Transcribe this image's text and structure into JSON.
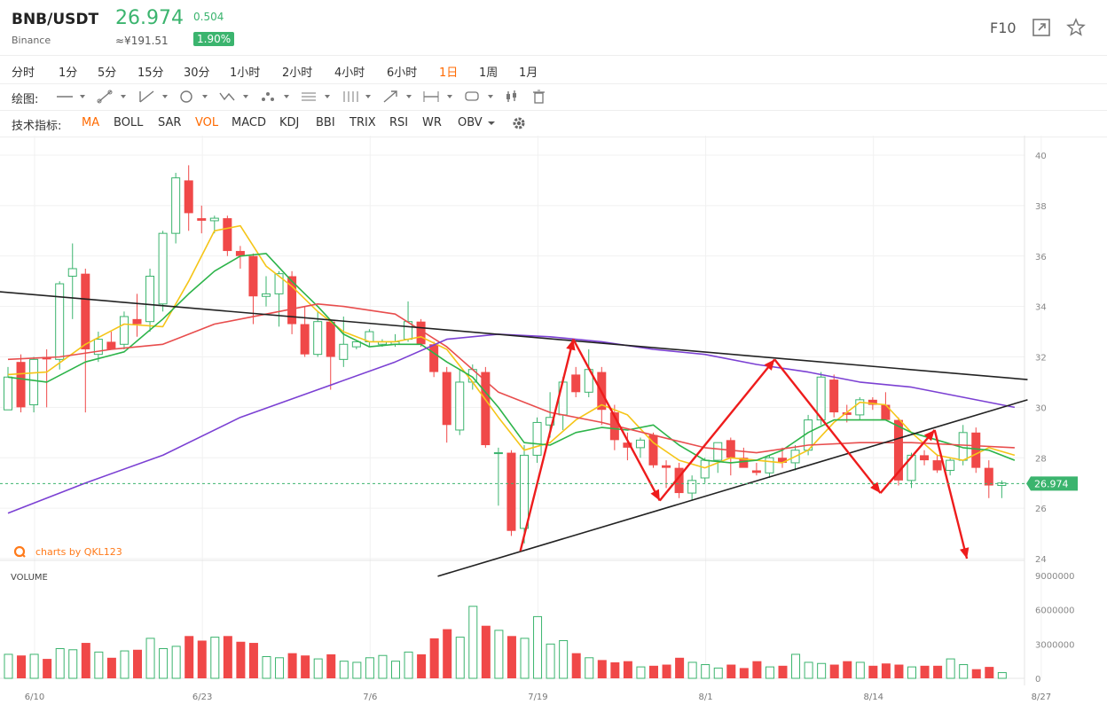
{
  "header": {
    "pair": "BNB/USDT",
    "exchange": "Binance",
    "price": "26.974",
    "cny_price": "≈¥191.51",
    "change": "0.504",
    "change_pct": "1.90%",
    "f10": "F10",
    "colors": {
      "up": "#3bb46e",
      "down": "#f04848",
      "active": "#ff6a00"
    }
  },
  "timeframes": [
    {
      "label": "分时"
    },
    {
      "label": "1分"
    },
    {
      "label": "5分"
    },
    {
      "label": "15分"
    },
    {
      "label": "30分"
    },
    {
      "label": "1小时"
    },
    {
      "label": "2小时"
    },
    {
      "label": "4小时"
    },
    {
      "label": "6小时"
    },
    {
      "label": "1日",
      "active": true
    },
    {
      "label": "1周"
    },
    {
      "label": "1月"
    }
  ],
  "drawing": {
    "label": "绘图:",
    "tools": [
      "line-tool-icon",
      "segment-tool-icon",
      "ray-tool-icon",
      "circle-tool-icon",
      "zigzag-tool-icon",
      "pattern-tool-icon",
      "fib-tool-icon",
      "channel-tool-icon",
      "arrow-tool-icon",
      "range-tool-icon",
      "text-tool-icon",
      "measure-icon",
      "trash-icon"
    ]
  },
  "indicators": {
    "label": "技术指标:",
    "items": [
      {
        "label": "MA",
        "active": true
      },
      {
        "label": "BOLL"
      },
      {
        "label": "SAR"
      },
      {
        "label": "VOL",
        "active": true
      },
      {
        "label": "MACD"
      },
      {
        "label": "KDJ"
      },
      {
        "label": "BBI"
      },
      {
        "label": "TRIX"
      },
      {
        "label": "RSI"
      },
      {
        "label": "WR"
      },
      {
        "label": "OBV"
      }
    ]
  },
  "watermark": "charts by QKL123",
  "chart_data": {
    "type": "candlestick",
    "interval": "1日",
    "price_axis": {
      "ticks": [
        "40",
        "38",
        "36",
        "34",
        "32",
        "30",
        "28",
        "26",
        "24"
      ],
      "range": [
        23.6,
        40.3
      ]
    },
    "volume_axis": {
      "label": "VOLUME",
      "ticks": [
        "9000000",
        "6000000",
        "3000000",
        "0"
      ],
      "range": [
        0,
        9000000
      ]
    },
    "date_ticks": [
      {
        "label": "6/10",
        "index": 0
      },
      {
        "label": "6/23",
        "index": 13
      },
      {
        "label": "7/6",
        "index": 26
      },
      {
        "label": "7/19",
        "index": 39
      },
      {
        "label": "8/1",
        "index": 52
      },
      {
        "label": "8/14",
        "index": 65
      },
      {
        "label": "8/27",
        "index": 78
      }
    ],
    "last_price": "26.974",
    "candles": [
      [
        29.9,
        31.6,
        30.0,
        31.2
      ],
      [
        31.8,
        32.1,
        29.8,
        30.0
      ],
      [
        30.1,
        32.0,
        29.8,
        31.9
      ],
      [
        32.0,
        32.3,
        30.0,
        31.9
      ],
      [
        31.9,
        35.0,
        31.5,
        34.9
      ],
      [
        35.2,
        36.5,
        33.5,
        35.5
      ],
      [
        35.3,
        35.5,
        29.8,
        32.3
      ],
      [
        32.1,
        33.0,
        31.8,
        32.7
      ],
      [
        32.6,
        33.0,
        32.3,
        32.3
      ],
      [
        32.5,
        33.8,
        32.3,
        33.6
      ],
      [
        33.5,
        34.5,
        32.8,
        33.3
      ],
      [
        33.4,
        35.5,
        33.0,
        35.2
      ],
      [
        34.1,
        37.0,
        33.8,
        36.9
      ],
      [
        36.9,
        39.3,
        36.5,
        39.1
      ],
      [
        39.0,
        39.6,
        37.0,
        37.7
      ],
      [
        37.5,
        38.0,
        36.9,
        37.4
      ],
      [
        37.4,
        37.6,
        36.9,
        37.5
      ],
      [
        37.5,
        37.6,
        36.0,
        36.2
      ],
      [
        36.2,
        36.4,
        35.5,
        36.0
      ],
      [
        36.0,
        36.1,
        33.3,
        34.4
      ],
      [
        34.4,
        35.2,
        34.0,
        34.5
      ],
      [
        34.5,
        35.4,
        33.2,
        35.3
      ],
      [
        35.2,
        35.4,
        32.9,
        33.3
      ],
      [
        33.3,
        34.0,
        32.0,
        32.1
      ],
      [
        32.1,
        33.8,
        32.0,
        33.4
      ],
      [
        33.4,
        33.5,
        30.7,
        32.0
      ],
      [
        31.9,
        33.6,
        31.6,
        32.5
      ],
      [
        32.4,
        32.6,
        32.3,
        32.6
      ],
      [
        32.6,
        33.1,
        32.4,
        33.0
      ],
      [
        32.5,
        32.7,
        32.4,
        32.6
      ],
      [
        32.5,
        32.9,
        32.4,
        32.6
      ],
      [
        32.7,
        34.2,
        32.6,
        33.4
      ],
      [
        33.4,
        33.5,
        32.4,
        32.5
      ],
      [
        32.5,
        32.6,
        31.2,
        31.4
      ],
      [
        31.4,
        31.6,
        28.6,
        29.3
      ],
      [
        29.1,
        31.5,
        28.9,
        31.0
      ],
      [
        31.0,
        31.7,
        30.7,
        31.5
      ],
      [
        31.4,
        31.6,
        28.4,
        28.5
      ],
      [
        28.2,
        28.4,
        26.1,
        28.2
      ],
      [
        28.2,
        28.3,
        24.9,
        25.1
      ],
      [
        25.2,
        28.5,
        24.6,
        28.1
      ],
      [
        28.1,
        29.6,
        27.8,
        29.4
      ],
      [
        29.3,
        30.6,
        28.8,
        29.6
      ],
      [
        29.7,
        31.2,
        29.1,
        31.0
      ],
      [
        31.3,
        31.6,
        30.4,
        30.6
      ],
      [
        30.6,
        32.3,
        30.4,
        31.5
      ],
      [
        31.4,
        31.6,
        29.3,
        29.9
      ],
      [
        29.8,
        30.1,
        28.3,
        28.7
      ],
      [
        28.6,
        29.0,
        27.9,
        28.4
      ],
      [
        28.4,
        28.8,
        28.0,
        28.7
      ],
      [
        28.9,
        29.0,
        27.6,
        27.7
      ],
      [
        27.7,
        27.9,
        26.8,
        27.6
      ],
      [
        27.6,
        27.8,
        26.4,
        26.6
      ],
      [
        26.6,
        27.3,
        26.3,
        27.1
      ],
      [
        27.2,
        28.0,
        27.0,
        27.9
      ],
      [
        27.9,
        28.4,
        27.4,
        28.6
      ],
      [
        28.7,
        28.8,
        27.3,
        28.0
      ],
      [
        28.0,
        28.4,
        27.8,
        27.6
      ],
      [
        27.5,
        27.8,
        27.3,
        27.4
      ],
      [
        27.4,
        28.1,
        27.2,
        28.0
      ],
      [
        28.0,
        28.4,
        27.6,
        27.8
      ],
      [
        27.8,
        28.5,
        27.5,
        28.3
      ],
      [
        28.3,
        29.7,
        28.1,
        29.5
      ],
      [
        29.5,
        31.4,
        29.3,
        31.2
      ],
      [
        31.1,
        31.3,
        29.6,
        29.8
      ],
      [
        29.8,
        30.1,
        29.4,
        29.7
      ],
      [
        29.7,
        30.4,
        29.5,
        30.3
      ],
      [
        30.3,
        30.4,
        29.9,
        30.1
      ],
      [
        30.1,
        30.6,
        29.6,
        29.5
      ],
      [
        29.5,
        29.6,
        26.9,
        27.1
      ],
      [
        27.1,
        28.2,
        26.8,
        28.1
      ],
      [
        28.1,
        28.3,
        27.7,
        27.9
      ],
      [
        27.9,
        28.1,
        27.4,
        27.5
      ],
      [
        27.5,
        28.0,
        27.3,
        27.9
      ],
      [
        27.9,
        29.3,
        27.7,
        29.0
      ],
      [
        29.0,
        29.2,
        27.4,
        27.6
      ],
      [
        27.6,
        27.9,
        26.4,
        26.9
      ],
      [
        26.9,
        27.1,
        26.4,
        27.0
      ]
    ],
    "volumes": [
      2100000,
      2000000,
      2100000,
      1700000,
      2600000,
      2500000,
      3100000,
      2300000,
      1800000,
      2400000,
      2500000,
      3500000,
      2600000,
      2800000,
      3700000,
      3300000,
      3600000,
      3700000,
      3200000,
      3100000,
      1900000,
      1800000,
      2200000,
      2000000,
      1700000,
      2100000,
      1500000,
      1400000,
      1800000,
      2000000,
      1500000,
      2300000,
      2100000,
      3500000,
      4300000,
      3600000,
      6300000,
      4600000,
      4200000,
      3700000,
      3500000,
      5400000,
      3000000,
      3300000,
      2200000,
      1800000,
      1600000,
      1400000,
      1500000,
      1000000,
      1100000,
      1200000,
      1800000,
      1400000,
      1200000,
      900000,
      1200000,
      900000,
      1500000,
      1000000,
      1100000,
      2100000,
      1400000,
      1300000,
      1200000,
      1500000,
      1400000,
      1100000,
      1300000,
      1200000,
      1000000,
      1100000,
      1100000,
      1700000,
      1200000,
      800000,
      1000000,
      500000
    ],
    "moving_averages": [
      {
        "color": "#f5c518",
        "values": [
          [
            0,
            31.3
          ],
          [
            3,
            31.4
          ],
          [
            6,
            32.5
          ],
          [
            9,
            33.3
          ],
          [
            12,
            33.2
          ],
          [
            14,
            35.0
          ],
          [
            16,
            37.0
          ],
          [
            18,
            37.2
          ],
          [
            20,
            35.6
          ],
          [
            22,
            34.8
          ],
          [
            24,
            33.8
          ],
          [
            26,
            33.0
          ],
          [
            28,
            32.6
          ],
          [
            30,
            32.6
          ],
          [
            32,
            32.8
          ],
          [
            34,
            32.3
          ],
          [
            36,
            31.0
          ],
          [
            38,
            29.6
          ],
          [
            40,
            28.3
          ],
          [
            42,
            28.6
          ],
          [
            44,
            29.5
          ],
          [
            46,
            30.1
          ],
          [
            48,
            29.7
          ],
          [
            50,
            28.6
          ],
          [
            52,
            27.9
          ],
          [
            54,
            27.6
          ],
          [
            56,
            28.0
          ],
          [
            58,
            27.9
          ],
          [
            60,
            27.8
          ],
          [
            62,
            28.3
          ],
          [
            64,
            29.4
          ],
          [
            66,
            30.2
          ],
          [
            68,
            30.1
          ],
          [
            70,
            29.0
          ],
          [
            72,
            28.1
          ],
          [
            74,
            27.9
          ],
          [
            76,
            28.4
          ],
          [
            78,
            28.1
          ]
        ]
      },
      {
        "color": "#2db44a",
        "values": [
          [
            0,
            31.2
          ],
          [
            3,
            31.0
          ],
          [
            6,
            31.8
          ],
          [
            9,
            32.2
          ],
          [
            12,
            33.5
          ],
          [
            14,
            34.5
          ],
          [
            16,
            35.4
          ],
          [
            18,
            36.0
          ],
          [
            20,
            36.1
          ],
          [
            22,
            35.0
          ],
          [
            24,
            34.0
          ],
          [
            26,
            32.9
          ],
          [
            28,
            32.4
          ],
          [
            30,
            32.5
          ],
          [
            32,
            32.5
          ],
          [
            34,
            31.8
          ],
          [
            36,
            31.2
          ],
          [
            38,
            30.0
          ],
          [
            40,
            28.6
          ],
          [
            42,
            28.5
          ],
          [
            44,
            29.0
          ],
          [
            46,
            29.2
          ],
          [
            48,
            29.1
          ],
          [
            50,
            29.3
          ],
          [
            52,
            28.5
          ],
          [
            54,
            27.9
          ],
          [
            56,
            27.8
          ],
          [
            58,
            27.9
          ],
          [
            60,
            28.3
          ],
          [
            62,
            29.0
          ],
          [
            64,
            29.5
          ],
          [
            66,
            29.5
          ],
          [
            68,
            29.5
          ],
          [
            70,
            29.0
          ],
          [
            72,
            28.7
          ],
          [
            74,
            28.4
          ],
          [
            76,
            28.3
          ],
          [
            78,
            27.9
          ]
        ]
      },
      {
        "color": "#e84d4d",
        "values": [
          [
            0,
            31.9
          ],
          [
            4,
            32.0
          ],
          [
            8,
            32.3
          ],
          [
            12,
            32.5
          ],
          [
            16,
            33.3
          ],
          [
            20,
            33.7
          ],
          [
            24,
            34.1
          ],
          [
            26,
            34.0
          ],
          [
            30,
            33.7
          ],
          [
            34,
            32.4
          ],
          [
            38,
            30.6
          ],
          [
            42,
            29.8
          ],
          [
            46,
            29.4
          ],
          [
            50,
            28.9
          ],
          [
            54,
            28.4
          ],
          [
            58,
            28.2
          ],
          [
            62,
            28.5
          ],
          [
            66,
            28.6
          ],
          [
            70,
            28.6
          ],
          [
            74,
            28.5
          ],
          [
            78,
            28.4
          ]
        ]
      },
      {
        "color": "#7b40d3",
        "values": [
          [
            0,
            25.8
          ],
          [
            6,
            27.0
          ],
          [
            12,
            28.1
          ],
          [
            18,
            29.6
          ],
          [
            24,
            30.7
          ],
          [
            30,
            31.8
          ],
          [
            34,
            32.7
          ],
          [
            38,
            32.9
          ],
          [
            42,
            32.8
          ],
          [
            46,
            32.6
          ],
          [
            50,
            32.3
          ],
          [
            54,
            32.1
          ],
          [
            58,
            31.7
          ],
          [
            62,
            31.4
          ],
          [
            66,
            31.0
          ],
          [
            70,
            30.8
          ],
          [
            74,
            30.4
          ],
          [
            78,
            30.0
          ]
        ]
      }
    ],
    "annotations": {
      "black_lines": [
        {
          "from": [
            -1,
            34.6
          ],
          "to": [
            79,
            31.1
          ]
        },
        {
          "from": [
            33.3,
            23.3
          ],
          "to": [
            79,
            30.3
          ]
        }
      ],
      "red_arrows": [
        {
          "points": [
            [
              39.7,
              24.3
            ],
            [
              43.8,
              32.7
            ],
            [
              50.5,
              26.3
            ],
            [
              59.4,
              31.9
            ],
            [
              67.6,
              26.6
            ],
            [
              71.8,
              29.1
            ],
            [
              74.3,
              24.0
            ]
          ]
        }
      ]
    }
  }
}
